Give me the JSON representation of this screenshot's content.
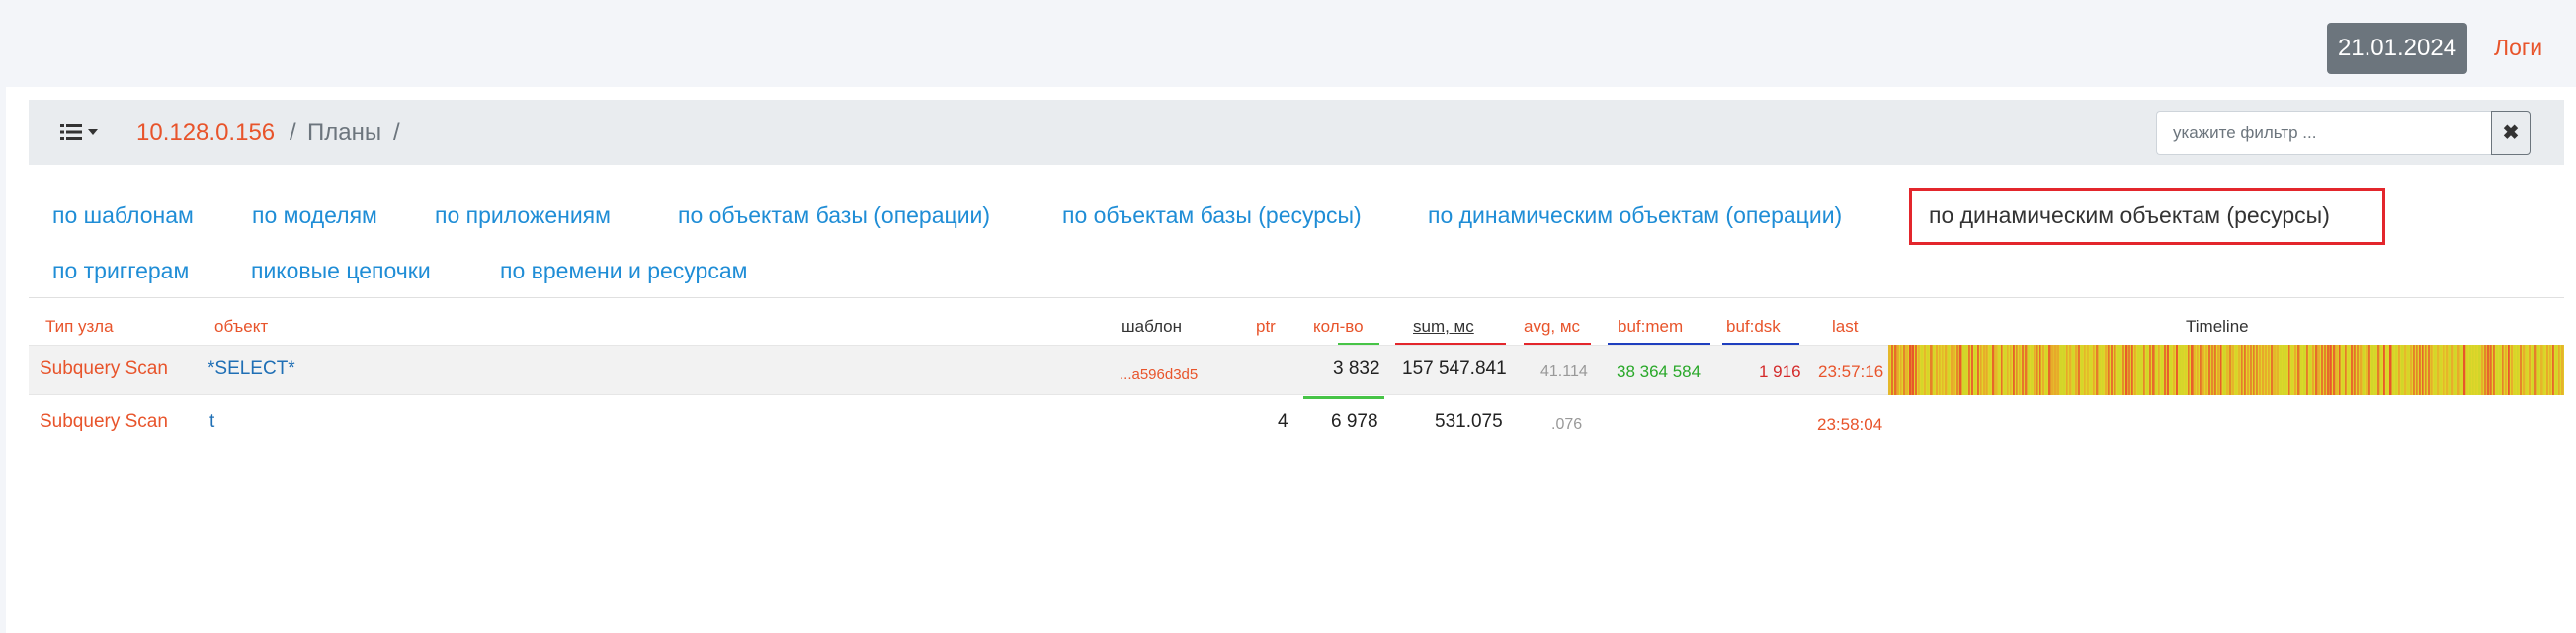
{
  "header": {
    "date": "21.01.2024",
    "logs_label": "Логи"
  },
  "breadcrumb": {
    "host": "10.128.0.156",
    "separator": "/",
    "section": "Планы"
  },
  "filter": {
    "placeholder": "укажите фильтр ...",
    "value": "",
    "clear_label": "✖"
  },
  "tabs": [
    {
      "label": "по шаблонам",
      "active": false
    },
    {
      "label": "по моделям",
      "active": false
    },
    {
      "label": "по приложениям",
      "active": false
    },
    {
      "label": "по объектам базы (операции)",
      "active": false
    },
    {
      "label": "по объектам базы (ресурсы)",
      "active": false
    },
    {
      "label": "по динамическим объектам (операции)",
      "active": false
    },
    {
      "label": "по динамическим объектам (ресурсы)",
      "active": true
    },
    {
      "label": "по триггерам",
      "active": false
    },
    {
      "label": "пиковые цепочки",
      "active": false
    },
    {
      "label": "по времени и ресурсам",
      "active": false
    }
  ],
  "table": {
    "columns": {
      "node_type": "Тип узла",
      "object": "объект",
      "template": "шаблон",
      "ptr": "ptr",
      "count": "кол-во",
      "sum": "sum, мс",
      "avg": "avg, мс",
      "buf_mem": "buf:mem",
      "buf_dsk": "buf:dsk",
      "last": "last",
      "timeline": "Timeline"
    },
    "colors": {
      "count": "#47c447",
      "sum": "#e3262c",
      "avg": "#e3262c",
      "buf_mem": "#1f3fbf",
      "buf_dsk": "#1f3fbf"
    },
    "rows": [
      {
        "node_type": "Subquery Scan",
        "object": "*SELECT*",
        "template": "...a596d3d5",
        "ptr": "",
        "count": "3 832",
        "sum": "157 547.841",
        "avg": "41.114",
        "buf_mem": "38 364 584",
        "buf_dsk": "1 916",
        "last": "23:57:16",
        "has_timeline": true
      },
      {
        "node_type": "Subquery Scan",
        "object": "t",
        "template": "",
        "ptr": "4",
        "count": "6 978",
        "sum": "531.075",
        "avg": ".076",
        "buf_mem": "",
        "buf_dsk": "",
        "last": "23:58:04",
        "has_timeline": false
      }
    ],
    "timeline_colors": [
      "#e0d52a",
      "#e8a52b",
      "#e8542b",
      "#cfd62a"
    ]
  }
}
